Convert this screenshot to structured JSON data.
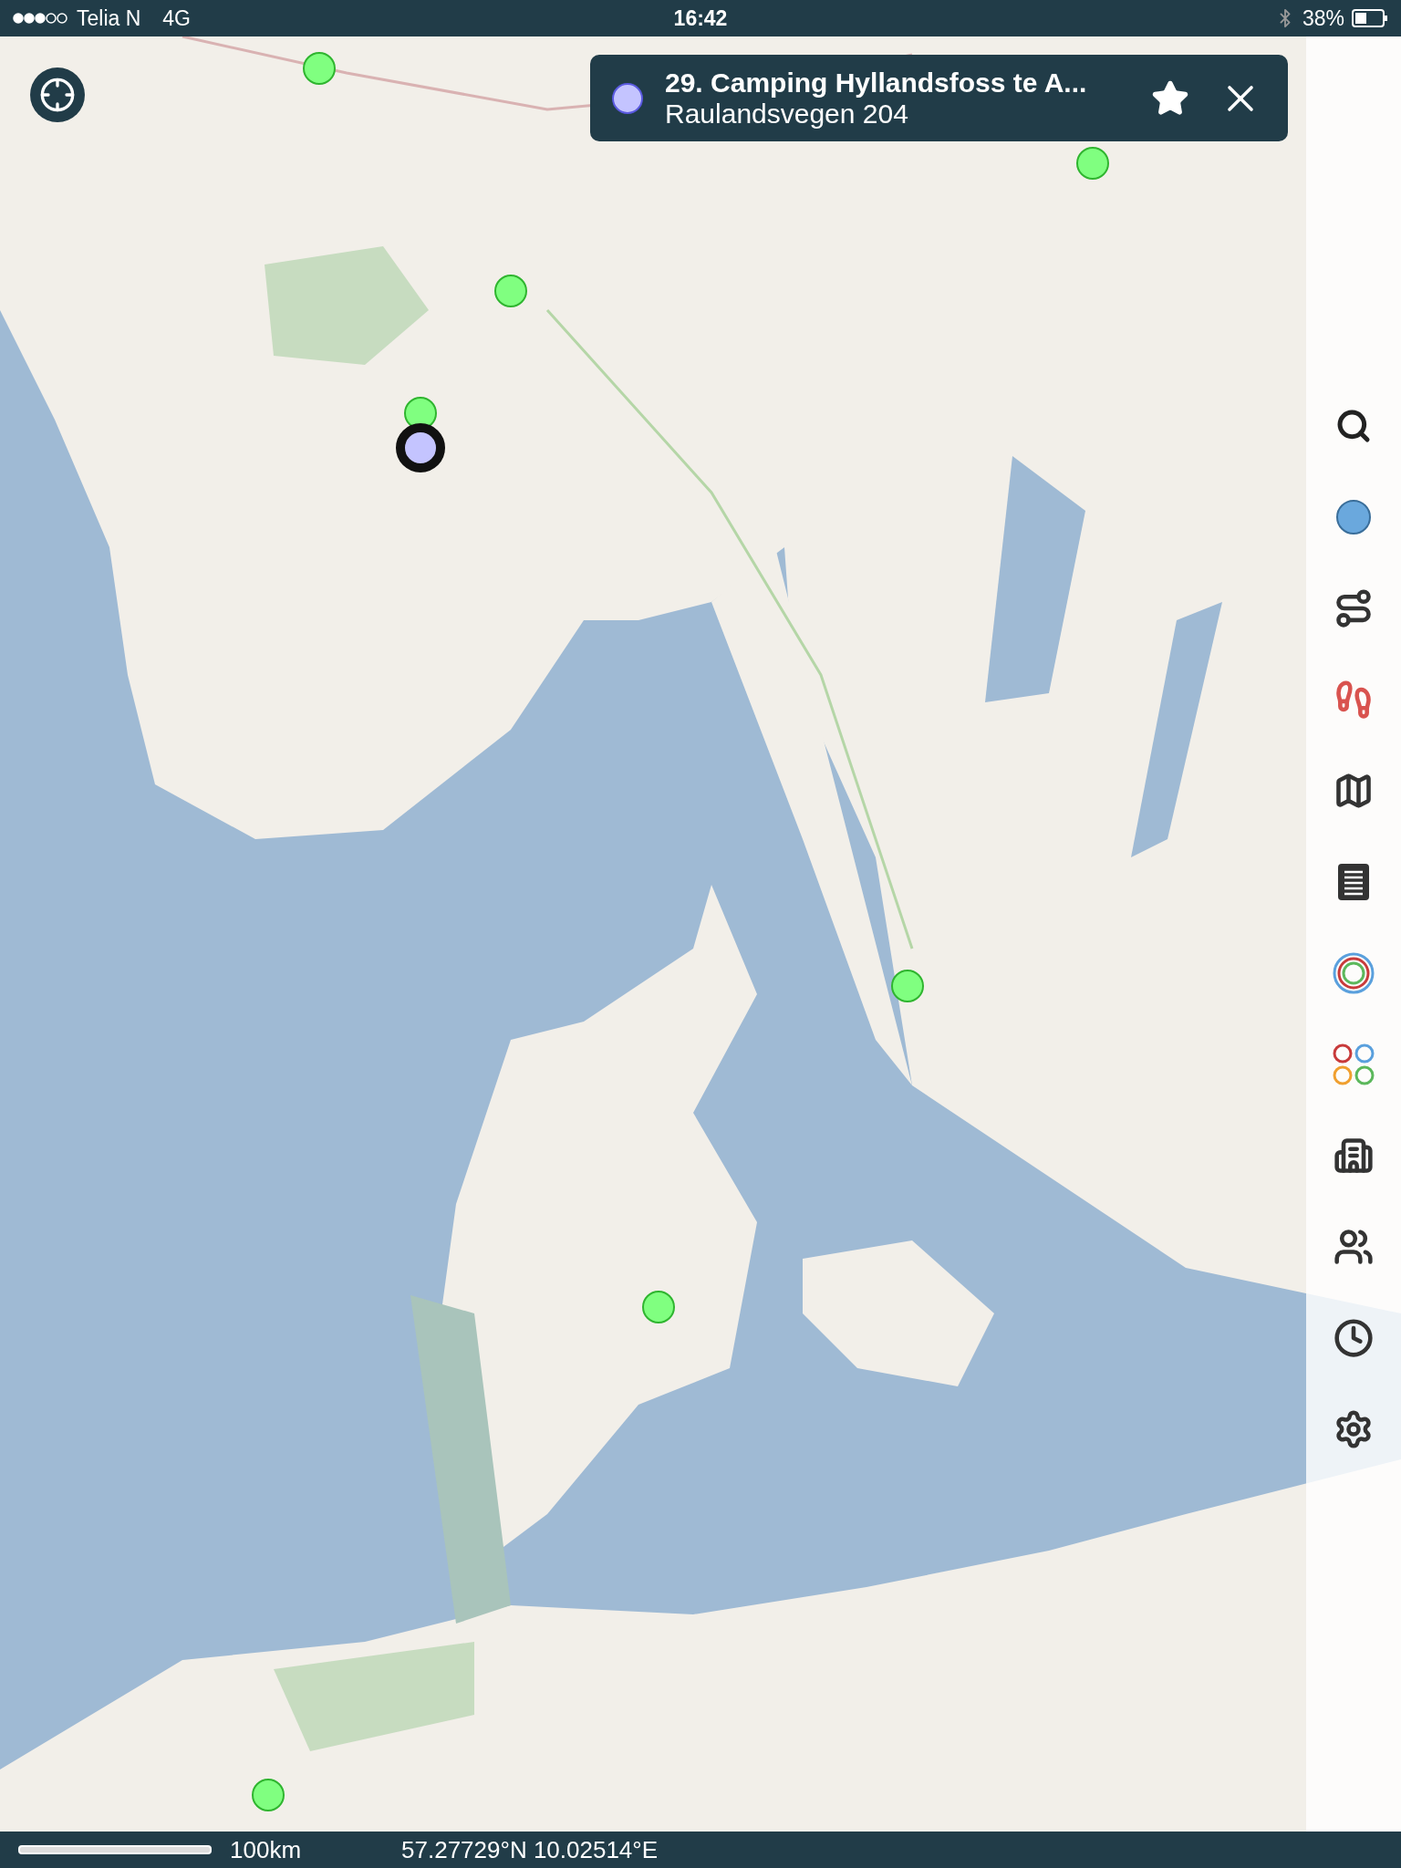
{
  "status_bar": {
    "carrier": "Telia N",
    "network": "4G",
    "time": "16:42",
    "battery": "38%"
  },
  "info_card": {
    "title": "29. Camping Hyllandsfoss te A...",
    "subtitle": "Raulandsvegen 204"
  },
  "markers": [
    {
      "selected": false
    },
    {
      "selected": false
    },
    {
      "selected": false
    },
    {
      "selected": false
    },
    {
      "selected": true
    },
    {
      "selected": false
    },
    {
      "selected": false
    },
    {
      "selected": false
    }
  ],
  "sidebar": {
    "buttons": [
      {
        "kind": "search"
      },
      {
        "kind": "dot"
      },
      {
        "kind": "route"
      },
      {
        "kind": "hike"
      },
      {
        "kind": "map"
      },
      {
        "kind": "list"
      },
      {
        "kind": "rings"
      },
      {
        "kind": "circles"
      },
      {
        "kind": "city"
      },
      {
        "kind": "people"
      },
      {
        "kind": "clock"
      },
      {
        "kind": "settings"
      }
    ]
  },
  "bottom_bar": {
    "scale": "100km",
    "coordinates": "57.27729°N 10.02514°E"
  }
}
